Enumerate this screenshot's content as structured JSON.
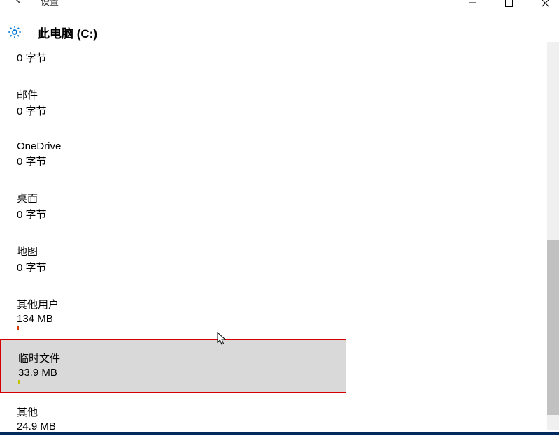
{
  "window": {
    "title": "设置",
    "page_title": "此电脑 (C:)"
  },
  "storage": {
    "item0": {
      "size": "0 字节"
    },
    "mail": {
      "name": "邮件",
      "size": "0 字节"
    },
    "onedrive": {
      "name": "OneDrive",
      "size": "0 字节"
    },
    "desktop": {
      "name": "桌面",
      "size": "0 字节"
    },
    "maps": {
      "name": "地图",
      "size": "0 字节"
    },
    "other_users": {
      "name": "其他用户",
      "size": "134 MB"
    },
    "temp_files": {
      "name": "临时文件",
      "size": "33.9 MB"
    },
    "other": {
      "name": "其他",
      "size": "24.9 MB"
    }
  }
}
